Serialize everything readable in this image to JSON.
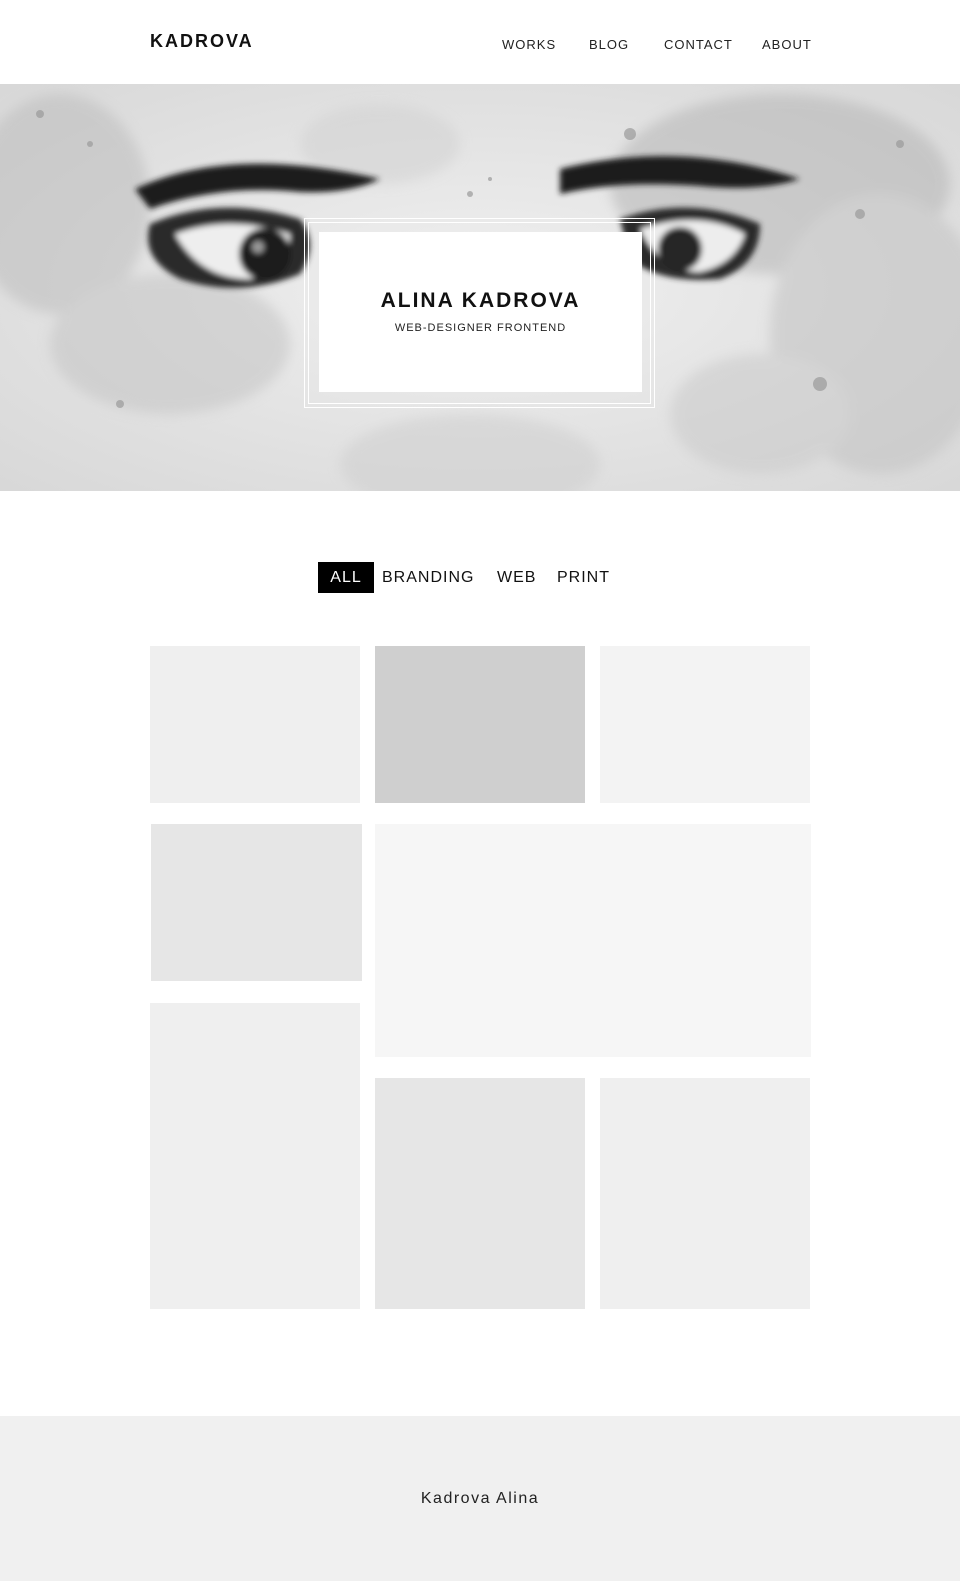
{
  "header": {
    "logo": "KADROVA",
    "nav": [
      {
        "label": "WORKS"
      },
      {
        "label": "BLOG"
      },
      {
        "label": "CONTACT"
      },
      {
        "label": "ABOUT"
      }
    ]
  },
  "hero": {
    "name": "ALINA KADROVA",
    "subtitle": "WEB-DESIGNER FRONTEND"
  },
  "filters": {
    "items": [
      {
        "label": "ALL",
        "active": true
      },
      {
        "label": "BRANDING",
        "active": false
      },
      {
        "label": "WEB",
        "active": false
      },
      {
        "label": "PRINT",
        "active": false
      }
    ]
  },
  "portfolio": {
    "tile_colors": [
      "#efefef",
      "#cfcfcf",
      "#f3f3f3",
      "#e6e6e6",
      "#f6f6f6",
      "#efefef",
      "#e6e6e6",
      "#efefef"
    ]
  },
  "footer": {
    "text": "Kadrova Alina"
  },
  "colors": {
    "accent": "#000000",
    "footer_bg": "#f0f0f0"
  }
}
